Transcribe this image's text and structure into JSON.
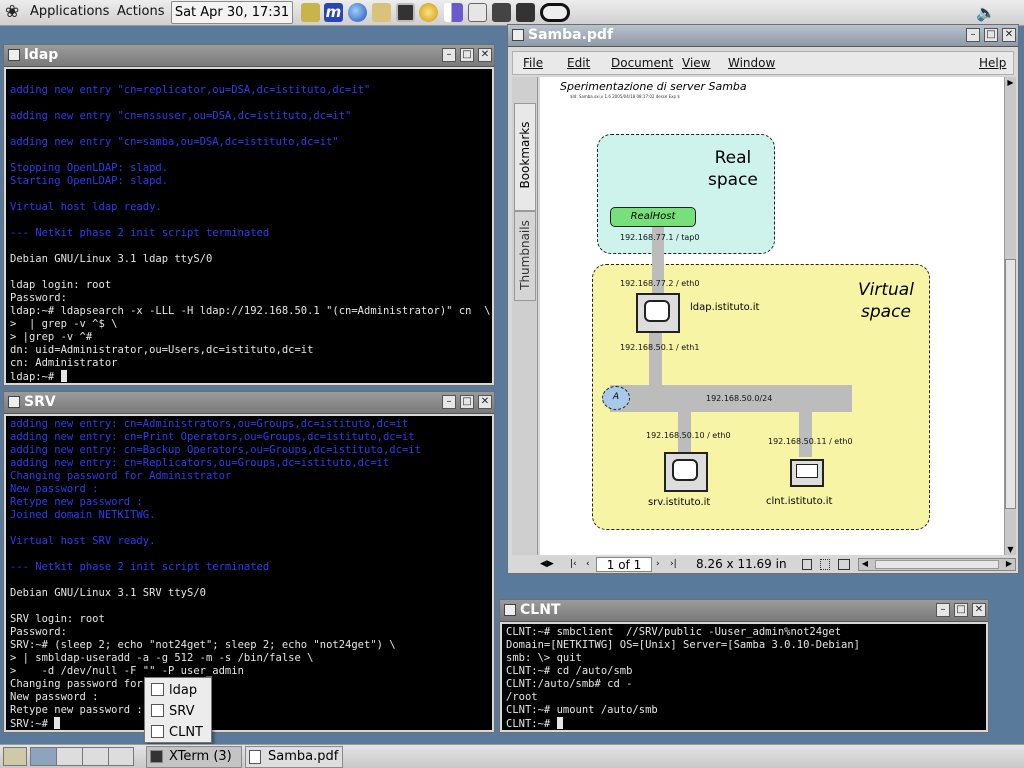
{
  "top_panel": {
    "menu_applications": "Applications",
    "menu_actions": "Actions",
    "clock": "Sat Apr 30, 17:31",
    "launchers": [
      "notes-icon",
      "m-icon",
      "globe-icon",
      "pen-icon",
      "terminal-icon",
      "mail-icon",
      "chart-icon",
      "monitor-icon",
      "calculator-icon",
      "headphones-icon",
      "glasses-icon"
    ],
    "volume": "volume-icon"
  },
  "windows": {
    "ldap": {
      "title": "ldap",
      "lines": [
        {
          "t": "",
          "c": "b"
        },
        {
          "t": "adding new entry \"cn=replicator,ou=DSA,dc=istituto,dc=it\"",
          "c": "b"
        },
        {
          "t": "",
          "c": "b"
        },
        {
          "t": "adding new entry \"cn=nssuser,ou=DSA,dc=istituto,dc=it\"",
          "c": "b"
        },
        {
          "t": "",
          "c": "b"
        },
        {
          "t": "adding new entry \"cn=samba,ou=DSA,dc=istituto,dc=it\"",
          "c": "b"
        },
        {
          "t": "",
          "c": "b"
        },
        {
          "t": "Stopping OpenLDAP: slapd.",
          "c": "b"
        },
        {
          "t": "Starting OpenLDAP: slapd.",
          "c": "b"
        },
        {
          "t": "",
          "c": "b"
        },
        {
          "t": "Virtual host ldap ready.",
          "c": "b"
        },
        {
          "t": "",
          "c": "b"
        },
        {
          "t": "--- Netkit phase 2 init script terminated",
          "c": "b"
        },
        {
          "t": "",
          "c": ""
        },
        {
          "t": "Debian GNU/Linux 3.1 ldap ttyS/0",
          "c": ""
        },
        {
          "t": "",
          "c": ""
        },
        {
          "t": "ldap login: root",
          "c": ""
        },
        {
          "t": "Password:",
          "c": ""
        },
        {
          "t": "ldap:~# ldapsearch -x -LLL -H ldap://192.168.50.1 \"(cn=Administrator)\" cn  \\",
          "c": ""
        },
        {
          "t": ">  | grep -v ^$ \\",
          "c": ""
        },
        {
          "t": "> |grep -v ^#",
          "c": ""
        },
        {
          "t": "dn: uid=Administrator,ou=Users,dc=istituto,dc=it",
          "c": ""
        },
        {
          "t": "cn: Administrator",
          "c": ""
        },
        {
          "t": "ldap:~# ",
          "c": "",
          "cursor": true
        }
      ]
    },
    "srv": {
      "title": "SRV",
      "lines": [
        {
          "t": "adding new entry: cn=Administrators,ou=Groups,dc=istituto,dc=it",
          "c": "b"
        },
        {
          "t": "adding new entry: cn=Print Operators,ou=Groups,dc=istituto,dc=it",
          "c": "b"
        },
        {
          "t": "adding new entry: cn=Backup Operators,ou=Groups,dc=istituto,dc=it",
          "c": "b"
        },
        {
          "t": "adding new entry: cn=Replicators,ou=Groups,dc=istituto,dc=it",
          "c": "b"
        },
        {
          "t": "Changing password for Administrator",
          "c": "b"
        },
        {
          "t": "New password :",
          "c": "b"
        },
        {
          "t": "Retype new password :",
          "c": "b"
        },
        {
          "t": "Joined domain NETKITWG.",
          "c": "b"
        },
        {
          "t": "",
          "c": "b"
        },
        {
          "t": "Virtual host SRV ready.",
          "c": "b"
        },
        {
          "t": "",
          "c": "b"
        },
        {
          "t": "--- Netkit phase 2 init script terminated",
          "c": "b"
        },
        {
          "t": "",
          "c": ""
        },
        {
          "t": "Debian GNU/Linux 3.1 SRV ttyS/0",
          "c": ""
        },
        {
          "t": "",
          "c": ""
        },
        {
          "t": "SRV login: root",
          "c": ""
        },
        {
          "t": "Password:",
          "c": ""
        },
        {
          "t": "SRV:~# (sleep 2; echo \"not24get\"; sleep 2; echo \"not24get\") \\",
          "c": ""
        },
        {
          "t": "> | smbldap-useradd -a -g 512 -m -s /bin/false \\",
          "c": ""
        },
        {
          "t": ">    -d /dev/null -F \"\" -P user_admin",
          "c": ""
        },
        {
          "t": "Changing password for u",
          "c": ""
        },
        {
          "t": "New password :",
          "c": ""
        },
        {
          "t": "Retype new password :",
          "c": ""
        },
        {
          "t": "SRV:~# ",
          "c": "",
          "cursor": true
        }
      ]
    },
    "clnt": {
      "title": "CLNT",
      "lines": [
        {
          "t": "CLNT:~# smbclient  //SRV/public -Uuser_admin%not24get",
          "c": ""
        },
        {
          "t": "Domain=[NETKITWG] OS=[Unix] Server=[Samba 3.0.10-Debian]",
          "c": ""
        },
        {
          "t": "smb: \\> quit",
          "c": ""
        },
        {
          "t": "CLNT:~# cd /auto/smb",
          "c": ""
        },
        {
          "t": "CLNT:/auto/smb# cd -",
          "c": ""
        },
        {
          "t": "/root",
          "c": ""
        },
        {
          "t": "CLNT:~# umount /auto/smb",
          "c": ""
        },
        {
          "t": "CLNT:~# ",
          "c": "",
          "cursor": true
        }
      ]
    },
    "pdf": {
      "title": "Samba.pdf",
      "menu": [
        "File",
        "Edit",
        "Document",
        "View",
        "Window",
        "Help"
      ],
      "side_tabs": [
        "Bookmarks",
        "Thumbnails"
      ],
      "page_title": "Sperimentazione di server Samba",
      "page_meta": "$Id: Samba.sxi,v 1.6 2005/04/18 08:17:02 desse Exp $",
      "diagram": {
        "real_space": "Real\nspace",
        "virtual_space": "Virtual\nspace",
        "realhost": "RealHost",
        "tap0": "192.168.77.1 / tap0",
        "ldap_eth0": "192.168.77.2 / eth0",
        "ldap_host": "ldap.istituto.it",
        "ldap_eth1": "192.168.50.1 / eth1",
        "coll": "A",
        "net": "192.168.50.0/24",
        "srv_eth0": "192.168.50.10 / eth0",
        "srv_host": "srv.istituto.it",
        "clnt_eth0": "192.168.50.11 / eth0",
        "clnt_host": "clnt.istituto.it"
      },
      "page_field": "1 of 1",
      "page_size": "8.26 x 11.69 in"
    }
  },
  "popup_menu": [
    "ldap",
    "SRV",
    "CLNT"
  ],
  "taskbar": {
    "tasks": [
      "XTerm (3)",
      "Samba.pdf"
    ]
  }
}
